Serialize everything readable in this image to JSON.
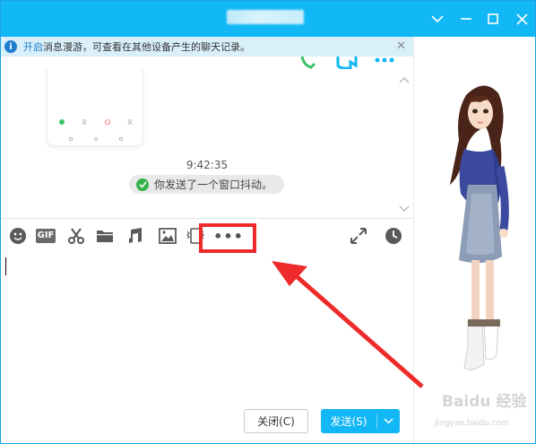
{
  "notice": {
    "link_text": "开启",
    "text": "消息漫游，可查看在其他设备产生的聊天记录。"
  },
  "history": {
    "time": "9:42:35",
    "shake_message": "你发送了一个窗口抖动。"
  },
  "toolbar": {
    "gif_label": "GIF",
    "more_label": "•••"
  },
  "buttons": {
    "close_label": "关闭(C)",
    "send_label": "发送(S)"
  },
  "watermark": {
    "logo": "Baidu 经验",
    "url": "jingyan.baidu.com"
  },
  "colors": {
    "titlebar": "#12b7f5",
    "notice_bg": "#d9f0fb",
    "highlight_red": "#ee2a2a",
    "send_button": "#12b7f5"
  },
  "icons": {
    "titlebar": [
      "chevron-down-icon",
      "minimize-icon",
      "maximize-icon",
      "close-icon"
    ],
    "toolbar": [
      "emoji-icon",
      "gif-icon",
      "scissors-icon",
      "folder-icon",
      "music-icon",
      "image-icon",
      "shake-icon",
      "more-icon",
      "expand-icon",
      "history-clock-icon"
    ]
  }
}
